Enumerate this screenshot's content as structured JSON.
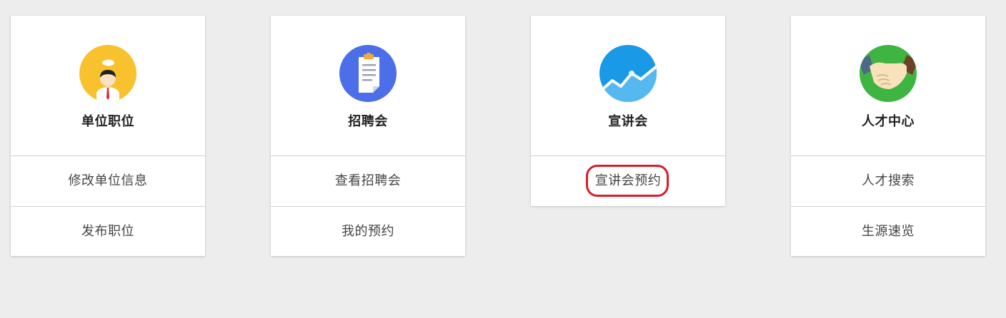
{
  "cards": [
    {
      "title": "单位职位",
      "icon": "employer-person-icon",
      "icon_color": "#f8c12e",
      "links": [
        "修改单位信息",
        "发布职位"
      ]
    },
    {
      "title": "招聘会",
      "icon": "clipboard-document-icon",
      "icon_color": "#4c6ee8",
      "links": [
        "查看招聘会",
        "我的预约"
      ]
    },
    {
      "title": "宣讲会",
      "icon": "trend-chart-icon",
      "icon_color": "#1999e6",
      "links": [
        "宣讲会预约"
      ],
      "highlighted_link": "宣讲会预约",
      "highlight_color": "#d81e2a"
    },
    {
      "title": "人才中心",
      "icon": "handshake-icon",
      "icon_color": "#3fb541",
      "links": [
        "人才搜索",
        "生源速览"
      ]
    }
  ],
  "background_color": "#ededed"
}
